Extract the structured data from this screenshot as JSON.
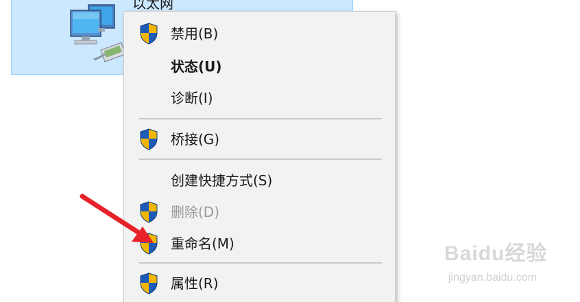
{
  "adapter": {
    "name": "以太网",
    "icon": "network-adapter-icon"
  },
  "menu": {
    "items": [
      {
        "label": "禁用(B)",
        "shield": true,
        "style": "normal"
      },
      {
        "label": "状态(U)",
        "shield": false,
        "style": "bold"
      },
      {
        "label": "诊断(I)",
        "shield": false,
        "style": "normal"
      },
      {
        "label": "桥接(G)",
        "shield": true,
        "style": "normal"
      },
      {
        "label": "创建快捷方式(S)",
        "shield": false,
        "style": "normal"
      },
      {
        "label": "删除(D)",
        "shield": true,
        "style": "disabled"
      },
      {
        "label": "重命名(M)",
        "shield": true,
        "style": "normal"
      },
      {
        "label": "属性(R)",
        "shield": true,
        "style": "normal"
      }
    ]
  },
  "annotation": {
    "arrow_color": "#e8222a",
    "points_to": "重命名(M)"
  },
  "watermark": {
    "brand": "Bai",
    "brand_paw": "du",
    "brand_suffix": "经验",
    "url": "jingyan.baidu.com"
  },
  "colors": {
    "selection_bg": "#cce8ff",
    "menu_bg": "#f2f2f2",
    "shield_blue": "#1e5bb8",
    "shield_yellow": "#f2b500"
  }
}
